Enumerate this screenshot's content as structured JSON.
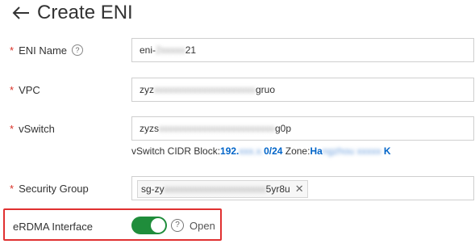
{
  "header": {
    "title": "Create ENI"
  },
  "form": {
    "eni_name": {
      "label": "ENI Name",
      "value_prefix": "eni-",
      "value_blur": "2xxxxx",
      "value_suffix": "21"
    },
    "vpc": {
      "label": "VPC",
      "value_prefix": "zyz",
      "value_blur": "xxxxxxxxxxxxxxxxxxxxx",
      "value_suffix": "gruo"
    },
    "vswitch": {
      "label": "vSwitch",
      "value_prefix": "zyzs",
      "value_blur": "xxxxxxxxxxxxxxxxxxxxxxxx",
      "value_suffix": "g0p",
      "cidr_label": "vSwitch CIDR Block:",
      "cidr_value_a": "192.",
      "cidr_value_blur": "xxx.x.",
      "cidr_value_b": "0/24",
      "zone_label": " Zone:",
      "zone_value_a": "Ha",
      "zone_value_blur": "ngzhou xxxxx",
      "zone_value_b": " K"
    },
    "security_group": {
      "label": "Security Group",
      "tag_prefix": "sg-zy",
      "tag_blur": "xxxxxxxxxxxxxxxxxxxxx",
      "tag_suffix": "5yr8u",
      "remove_symbol": "✕"
    },
    "erdma": {
      "label": "eRDMA Interface",
      "status": "Open",
      "enabled": true
    }
  },
  "colors": {
    "required": "#d93026",
    "toggle_on": "#1f8d3b",
    "highlight": "#e03131",
    "link": "#0064c8"
  }
}
